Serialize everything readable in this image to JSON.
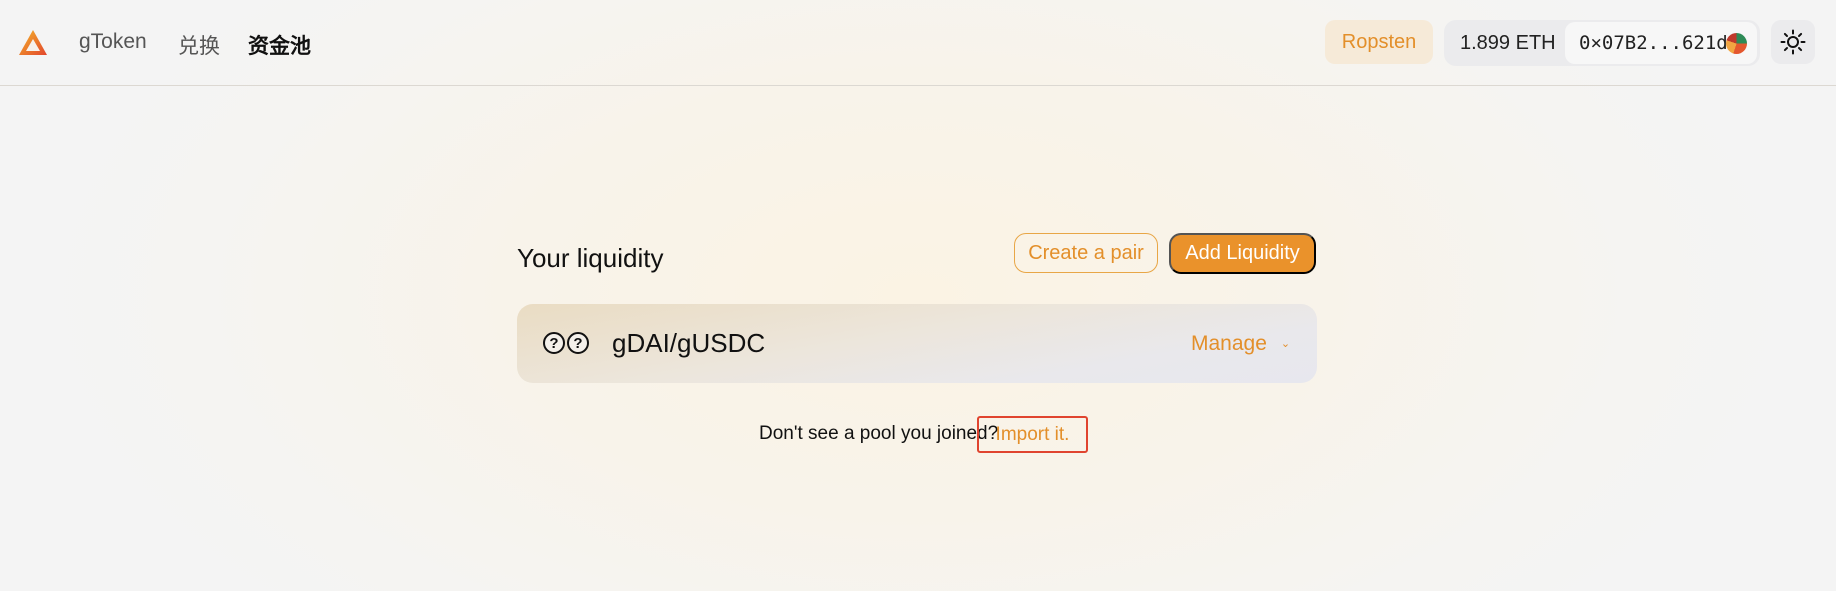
{
  "header": {
    "logo_icon": "triangle-logo-icon",
    "nav": [
      {
        "label": "gToken",
        "active": false
      },
      {
        "label": "兑换",
        "active": false
      },
      {
        "label": "资金池",
        "active": true
      }
    ],
    "network": "Ropsten",
    "balance": "1.899 ETH",
    "address": "0×07B2...621d",
    "theme_icon": "sun-icon"
  },
  "main": {
    "title": "Your liquidity",
    "create_pair_label": "Create a pair",
    "add_liquidity_label": "Add Liquidity",
    "pools": [
      {
        "pair": "gDAI/gUSDC",
        "manage_label": "Manage",
        "token_icons": [
          "unknown-token-icon",
          "unknown-token-icon"
        ]
      }
    ],
    "import_prompt": "Don't see a pool you joined?",
    "import_link": "Import it."
  },
  "colors": {
    "accent": "#ea922b",
    "accent_text": "#e38f2a",
    "highlight_border": "#e0442f"
  }
}
